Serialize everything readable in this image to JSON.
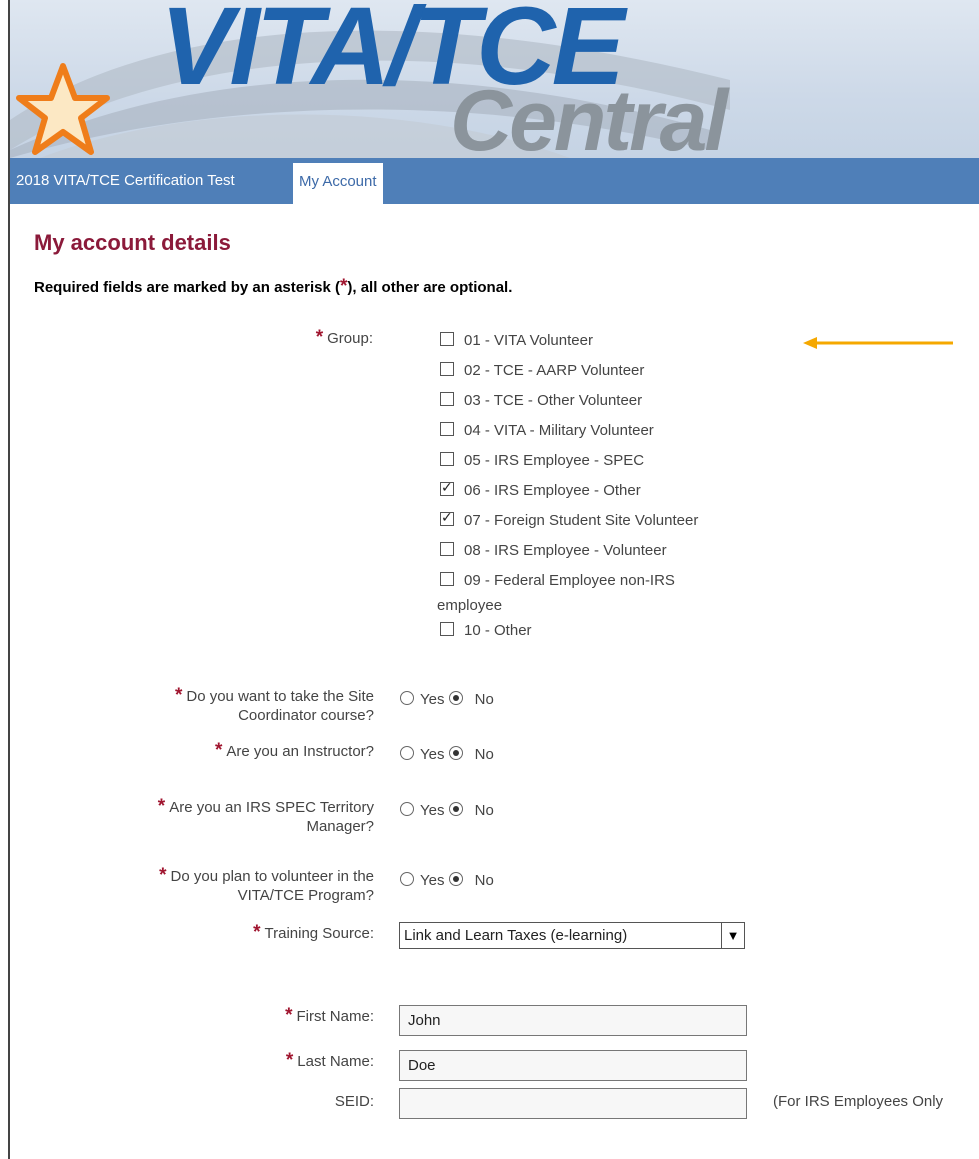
{
  "banner": {
    "logo_main": "VITA/TCE",
    "logo_sub": "Central"
  },
  "nav": {
    "tabs": [
      {
        "label": "2018 VITA/TCE Certification Test"
      },
      {
        "label": "My Account"
      }
    ]
  },
  "page": {
    "title": "My account details",
    "required_note_prefix": "Required fields are marked by an asterisk (",
    "required_note_ast": "*",
    "required_note_suffix": "), all other are optional."
  },
  "group": {
    "label": "Group:",
    "options": [
      {
        "label": "01 - VITA Volunteer",
        "checked": false
      },
      {
        "label": "02 - TCE - AARP Volunteer",
        "checked": false
      },
      {
        "label": "03 - TCE - Other Volunteer",
        "checked": false
      },
      {
        "label": "04 - VITA - Military Volunteer",
        "checked": false
      },
      {
        "label": "05 - IRS Employee - SPEC",
        "checked": false
      },
      {
        "label": "06 - IRS Employee - Other",
        "checked": true
      },
      {
        "label": "07 - Foreign Student Site Volunteer",
        "checked": true
      },
      {
        "label": "08 - IRS Employee - Volunteer",
        "checked": false
      },
      {
        "label": "09 - Federal Employee non-IRS",
        "checked": false,
        "wrap": "employee"
      },
      {
        "label": "10 - Other",
        "checked": false
      }
    ]
  },
  "questions": [
    {
      "line1": "Do you want to take the Site",
      "line2": "Coordinator course?",
      "yes": "Yes",
      "no": "No",
      "selected": "No"
    },
    {
      "line1": "Are you an Instructor?",
      "line2": "",
      "yes": "Yes",
      "no": "No",
      "selected": "No"
    },
    {
      "line1": "Are you an IRS SPEC Territory",
      "line2": "Manager?",
      "yes": "Yes",
      "no": "No",
      "selected": "No"
    },
    {
      "line1": "Do you plan to volunteer in the",
      "line2": "VITA/TCE Program?",
      "yes": "Yes",
      "no": "No",
      "selected": "No"
    }
  ],
  "training_source": {
    "label": "Training Source:",
    "value": "Link and Learn Taxes (e-learning)"
  },
  "first_name": {
    "label": "First Name:",
    "value": "John"
  },
  "last_name": {
    "label": "Last Name:",
    "value": "Doe"
  },
  "seid": {
    "label": "SEID:",
    "value": "",
    "note": "(For IRS Employees Only"
  },
  "colors": {
    "nav": "#4f7fb8",
    "title": "#8b1a3a",
    "asterisk": "#a0152f",
    "arrow": "#f5a800",
    "logo_blue": "#1f63ad",
    "logo_gray": "#8b949c"
  }
}
